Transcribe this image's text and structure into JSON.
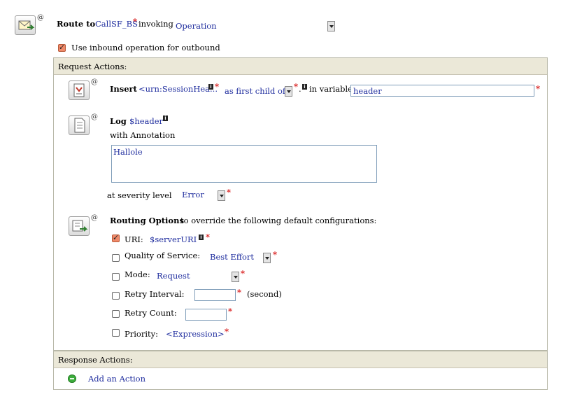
{
  "route": {
    "label": "Route to",
    "target": "CallSF_BS",
    "required": "*",
    "invoking_label": "invoking",
    "operation_value": "Operation",
    "use_inbound_label": "Use inbound operation for outbound",
    "use_inbound_checked": true,
    "at": "@"
  },
  "request_actions": {
    "header": "Request Actions:",
    "insert": {
      "keyword": "Insert",
      "expression": "<urn:SessionHea...",
      "required": "*",
      "position": "as first child of",
      "dot": ".",
      "in_variable_label": "in variable",
      "variable_value": "header"
    },
    "log": {
      "keyword": "Log",
      "expression": "$header",
      "annotation_label": "with Annotation",
      "annotation_value": "Hallole",
      "severity_label": "at severity level",
      "severity_value": "Error",
      "required": "*"
    },
    "routing_options": {
      "keyword": "Routing Options",
      "description": "to override the following default configurations:",
      "uri_label": "URI:",
      "uri_value": "$serverURI",
      "uri_checked": true,
      "qos_label": "Quality of Service:",
      "qos_value": "Best Effort",
      "mode_label": "Mode:",
      "mode_value": "Request",
      "retry_interval_label": "Retry Interval:",
      "retry_interval_unit": "(second)",
      "retry_count_label": "Retry Count:",
      "priority_label": "Priority:",
      "priority_value": "<Expression>",
      "required": "*"
    }
  },
  "response_actions": {
    "header": "Response Actions:",
    "add_action": "Add an Action"
  },
  "icons": {
    "info": "i",
    "at": "@"
  },
  "colors": {
    "link": "#1f2d9e",
    "required": "#d40000",
    "panel_header": "#ebe8d8",
    "add_icon": "#3cae3c"
  }
}
